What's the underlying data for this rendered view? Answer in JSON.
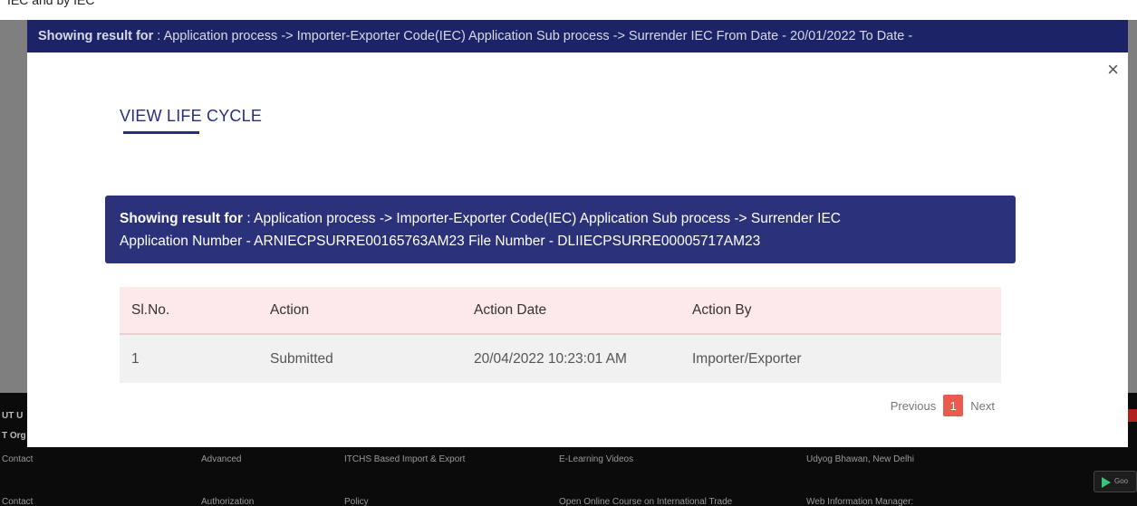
{
  "background": {
    "top_strip_text": "IEC and by IEC",
    "banner": {
      "label": "Showing result for",
      "text": " : Application process -> Importer-Exporter Code(IEC) Application Sub process -> Surrender IEC From Date - 20/01/2022 To Date -"
    },
    "footer": {
      "left_labels": [
        "UT U",
        "T Org",
        "Contact",
        "Contact"
      ],
      "col2": [
        "Advanced",
        "Authorization"
      ],
      "col3": [
        "ITCHS Based Import & Export",
        "Policy"
      ],
      "col4": [
        "E-Learning Videos",
        "Open Online Course on International Trade"
      ],
      "col5": [
        "Udyog Bhawan, New Delhi",
        "Web Information Manager:"
      ],
      "play_store_text": "Goo"
    }
  },
  "modal": {
    "close_symbol": "×",
    "title": "VIEW LIFE CYCLE",
    "result": {
      "label": "Showing result for",
      "line1": " : Application process -> Importer-Exporter Code(IEC) Application Sub process -> Surrender IEC",
      "line2": "Application Number - ARNIECPSURRE00165763AM23 File Number - DLIIECPSURRE00005717AM23"
    },
    "table": {
      "headers": [
        "Sl.No.",
        "Action",
        "Action Date",
        "Action By"
      ],
      "rows": [
        [
          "1",
          "Submitted",
          "20/04/2022 10:23:01 AM",
          "Importer/Exporter"
        ]
      ]
    },
    "pagination": {
      "previous": "Previous",
      "current": "1",
      "next": "Next"
    }
  },
  "colors": {
    "accent_navy": "#2b327a",
    "table_header_bg": "#fde9ea",
    "page_active": "#ea5a4f"
  }
}
